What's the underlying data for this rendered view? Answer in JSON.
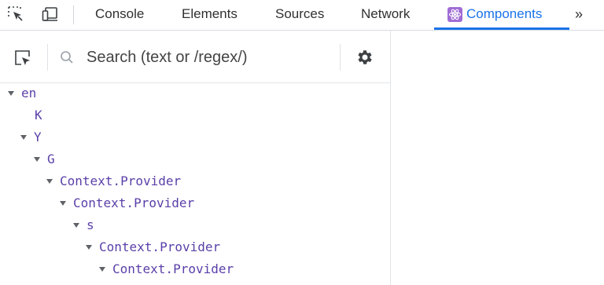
{
  "devtools": {
    "tabs": [
      {
        "label": "Console"
      },
      {
        "label": "Elements"
      },
      {
        "label": "Sources"
      },
      {
        "label": "Network"
      },
      {
        "label": "Components",
        "active": true
      }
    ],
    "more_tabs": "»",
    "accent_color": "#1a73e8"
  },
  "components": {
    "search_placeholder": "Search (text or /regex/)",
    "tree": [
      {
        "label": "en",
        "depth": 0,
        "expanded": true
      },
      {
        "label": "K",
        "depth": 1,
        "expanded": false
      },
      {
        "label": "Y",
        "depth": 1,
        "expanded": true
      },
      {
        "label": "G",
        "depth": 2,
        "expanded": true
      },
      {
        "label": "Context.Provider",
        "depth": 3,
        "expanded": true
      },
      {
        "label": "Context.Provider",
        "depth": 4,
        "expanded": true
      },
      {
        "label": "s",
        "depth": 5,
        "expanded": true
      },
      {
        "label": "Context.Provider",
        "depth": 6,
        "expanded": true
      },
      {
        "label": "Context.Provider",
        "depth": 7,
        "expanded": true
      }
    ],
    "component_name_color": "#5a3fa8"
  }
}
